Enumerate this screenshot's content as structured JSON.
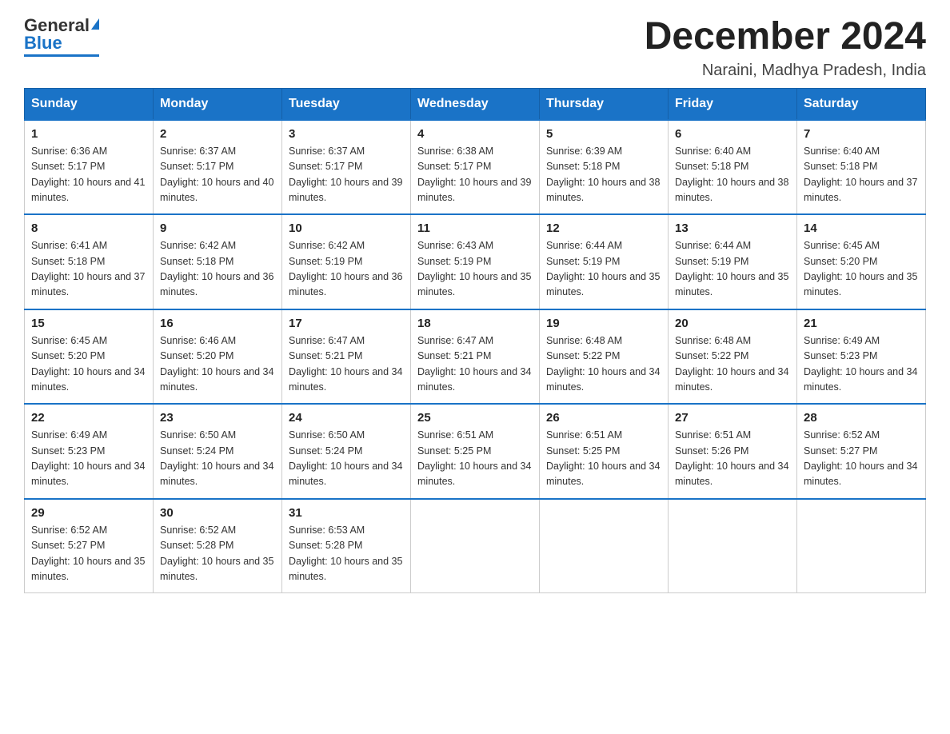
{
  "logo": {
    "text_general": "General",
    "text_blue": "Blue"
  },
  "header": {
    "month_title": "December 2024",
    "location": "Naraini, Madhya Pradesh, India"
  },
  "weekdays": [
    "Sunday",
    "Monday",
    "Tuesday",
    "Wednesday",
    "Thursday",
    "Friday",
    "Saturday"
  ],
  "weeks": [
    [
      {
        "day": "1",
        "sunrise": "6:36 AM",
        "sunset": "5:17 PM",
        "daylight": "10 hours and 41 minutes."
      },
      {
        "day": "2",
        "sunrise": "6:37 AM",
        "sunset": "5:17 PM",
        "daylight": "10 hours and 40 minutes."
      },
      {
        "day": "3",
        "sunrise": "6:37 AM",
        "sunset": "5:17 PM",
        "daylight": "10 hours and 39 minutes."
      },
      {
        "day": "4",
        "sunrise": "6:38 AM",
        "sunset": "5:17 PM",
        "daylight": "10 hours and 39 minutes."
      },
      {
        "day": "5",
        "sunrise": "6:39 AM",
        "sunset": "5:18 PM",
        "daylight": "10 hours and 38 minutes."
      },
      {
        "day": "6",
        "sunrise": "6:40 AM",
        "sunset": "5:18 PM",
        "daylight": "10 hours and 38 minutes."
      },
      {
        "day": "7",
        "sunrise": "6:40 AM",
        "sunset": "5:18 PM",
        "daylight": "10 hours and 37 minutes."
      }
    ],
    [
      {
        "day": "8",
        "sunrise": "6:41 AM",
        "sunset": "5:18 PM",
        "daylight": "10 hours and 37 minutes."
      },
      {
        "day": "9",
        "sunrise": "6:42 AM",
        "sunset": "5:18 PM",
        "daylight": "10 hours and 36 minutes."
      },
      {
        "day": "10",
        "sunrise": "6:42 AM",
        "sunset": "5:19 PM",
        "daylight": "10 hours and 36 minutes."
      },
      {
        "day": "11",
        "sunrise": "6:43 AM",
        "sunset": "5:19 PM",
        "daylight": "10 hours and 35 minutes."
      },
      {
        "day": "12",
        "sunrise": "6:44 AM",
        "sunset": "5:19 PM",
        "daylight": "10 hours and 35 minutes."
      },
      {
        "day": "13",
        "sunrise": "6:44 AM",
        "sunset": "5:19 PM",
        "daylight": "10 hours and 35 minutes."
      },
      {
        "day": "14",
        "sunrise": "6:45 AM",
        "sunset": "5:20 PM",
        "daylight": "10 hours and 35 minutes."
      }
    ],
    [
      {
        "day": "15",
        "sunrise": "6:45 AM",
        "sunset": "5:20 PM",
        "daylight": "10 hours and 34 minutes."
      },
      {
        "day": "16",
        "sunrise": "6:46 AM",
        "sunset": "5:20 PM",
        "daylight": "10 hours and 34 minutes."
      },
      {
        "day": "17",
        "sunrise": "6:47 AM",
        "sunset": "5:21 PM",
        "daylight": "10 hours and 34 minutes."
      },
      {
        "day": "18",
        "sunrise": "6:47 AM",
        "sunset": "5:21 PM",
        "daylight": "10 hours and 34 minutes."
      },
      {
        "day": "19",
        "sunrise": "6:48 AM",
        "sunset": "5:22 PM",
        "daylight": "10 hours and 34 minutes."
      },
      {
        "day": "20",
        "sunrise": "6:48 AM",
        "sunset": "5:22 PM",
        "daylight": "10 hours and 34 minutes."
      },
      {
        "day": "21",
        "sunrise": "6:49 AM",
        "sunset": "5:23 PM",
        "daylight": "10 hours and 34 minutes."
      }
    ],
    [
      {
        "day": "22",
        "sunrise": "6:49 AM",
        "sunset": "5:23 PM",
        "daylight": "10 hours and 34 minutes."
      },
      {
        "day": "23",
        "sunrise": "6:50 AM",
        "sunset": "5:24 PM",
        "daylight": "10 hours and 34 minutes."
      },
      {
        "day": "24",
        "sunrise": "6:50 AM",
        "sunset": "5:24 PM",
        "daylight": "10 hours and 34 minutes."
      },
      {
        "day": "25",
        "sunrise": "6:51 AM",
        "sunset": "5:25 PM",
        "daylight": "10 hours and 34 minutes."
      },
      {
        "day": "26",
        "sunrise": "6:51 AM",
        "sunset": "5:25 PM",
        "daylight": "10 hours and 34 minutes."
      },
      {
        "day": "27",
        "sunrise": "6:51 AM",
        "sunset": "5:26 PM",
        "daylight": "10 hours and 34 minutes."
      },
      {
        "day": "28",
        "sunrise": "6:52 AM",
        "sunset": "5:27 PM",
        "daylight": "10 hours and 34 minutes."
      }
    ],
    [
      {
        "day": "29",
        "sunrise": "6:52 AM",
        "sunset": "5:27 PM",
        "daylight": "10 hours and 35 minutes."
      },
      {
        "day": "30",
        "sunrise": "6:52 AM",
        "sunset": "5:28 PM",
        "daylight": "10 hours and 35 minutes."
      },
      {
        "day": "31",
        "sunrise": "6:53 AM",
        "sunset": "5:28 PM",
        "daylight": "10 hours and 35 minutes."
      },
      null,
      null,
      null,
      null
    ]
  ]
}
